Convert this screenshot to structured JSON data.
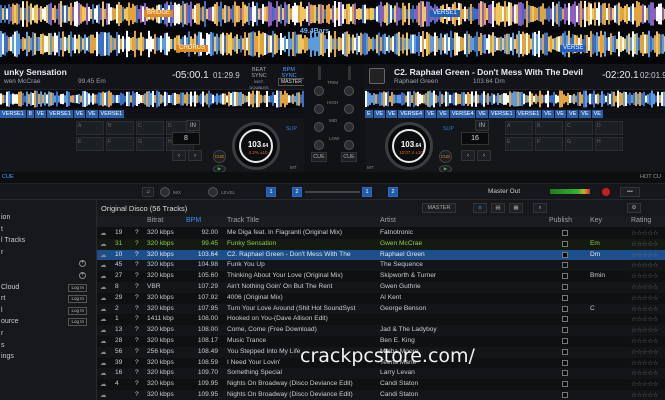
{
  "overview": {
    "markers_top": [
      {
        "label": "BRIDGE",
        "color": "orange"
      },
      {
        "label": "VERSE1",
        "color": "blue"
      }
    ],
    "markers_bottom": [
      {
        "label": "CHORUS",
        "color": "orange"
      },
      {
        "label": "VERSE",
        "color": "blue"
      }
    ],
    "bars_label": "49.4Bars"
  },
  "deck1": {
    "title": "unky Sensation",
    "artist": "wen McCrae",
    "bpm_key": "99.45 Em",
    "remain": "-05:00.1",
    "elapsed": "01:29.9",
    "sync_label": "BEAT SYNC",
    "sync_sub": "INST. DOUBLES",
    "bpm_sync": "BPM SYNC",
    "master": "MASTER",
    "cues": [
      "VERSE1",
      "8",
      "VE",
      "VERSE1",
      "VE",
      "VE",
      "VERSE1"
    ],
    "loop_value": "8",
    "beat_value": "1",
    "jog_bpm": "103",
    "jog_bpm_dec": ".64",
    "jog_sub": "4.2%  ±10",
    "cue_label": "CUE",
    "slip": "SLIP",
    "mt": "MT"
  },
  "deck2": {
    "title": "C2. Raphael Green - Don't Mess With The Devil",
    "artist": "Raphael Green",
    "bpm_key": "103.64 Dm",
    "remain": "-02:20.1",
    "elapsed": "02:01.9",
    "cues": [
      "E",
      "VE",
      "VE",
      "VERSE4",
      "VE",
      "VE",
      "VERSE4",
      "VE",
      "VERSE1",
      "VERSE1",
      "VE",
      "VE",
      "VE",
      "VE",
      "VE"
    ],
    "loop_value": "16",
    "beat_value": "1",
    "jog_bpm": "103",
    "jog_bpm_dec": ".64",
    "jog_sub": "10:07.4  ±10",
    "cue_label": "CUE",
    "slip": "SLIP",
    "mt": "MT"
  },
  "mixer": {
    "trim": "TRIM",
    "high": "HIGH",
    "mid": "MID",
    "low": "LOW",
    "cue": "CUE",
    "left_label": "CUE",
    "right_label": "HOT CU",
    "fx": "MIX",
    "level": "LEVEL"
  },
  "transport": {
    "master_out": "Master Out",
    "rec_label": "REC"
  },
  "sidebar": {
    "items": [
      {
        "label": "ion",
        "extra": ""
      },
      {
        "label": "t",
        "extra": ""
      },
      {
        "label": "l Tracks",
        "extra": ""
      },
      {
        "label": "r",
        "extra": ""
      },
      {
        "label": "",
        "extra": "plus"
      },
      {
        "label": "",
        "extra": "plus"
      },
      {
        "label": "Cloud",
        "extra": "Log In"
      },
      {
        "label": "rt",
        "extra": "Log In"
      },
      {
        "label": "l",
        "extra": "Log In"
      },
      {
        "label": "ource",
        "extra": "Log In"
      },
      {
        "label": "r",
        "extra": ""
      },
      {
        "label": "s",
        "extra": ""
      },
      {
        "label": "ings",
        "extra": ""
      }
    ]
  },
  "library": {
    "title": "Original Disco (56 Tracks)",
    "view_mode": "MASTER",
    "columns": {
      "bitrate": "Bitrat",
      "bpm": "BPM",
      "track": "Track Title",
      "artist": "Artist",
      "publish": "Publish",
      "key": "Key",
      "rating": "Rating"
    },
    "rows": [
      {
        "num": "19",
        "q": "?",
        "bitrate": "320 kbps",
        "bpm": "92.00",
        "title": "Me Diga feat. In Flagranti (Original Mix)",
        "artist": "Fatnotronic",
        "key": "",
        "state": ""
      },
      {
        "num": "31",
        "q": "?",
        "bitrate": "320 kbps",
        "bpm": "99.45",
        "title": "Funky Sensation",
        "artist": "Gwen McCrae",
        "key": "Em",
        "state": "loaded"
      },
      {
        "num": "10",
        "q": "?",
        "bitrate": "320 kbps",
        "bpm": "103.64",
        "title": "C2. Raphael Green - Don't Mess With The",
        "artist": "Raphael Green",
        "key": "Dm",
        "state": "playing"
      },
      {
        "num": "45",
        "q": "?",
        "bitrate": "320 kbps",
        "bpm": "104.98",
        "title": "Funk You Up",
        "artist": "The Sequence",
        "key": "",
        "state": ""
      },
      {
        "num": "27",
        "q": "?",
        "bitrate": "320 kbps",
        "bpm": "105.60",
        "title": "Thinking About Your Love (Original Mix)",
        "artist": "Skipworth & Turner",
        "key": "Bmin",
        "state": ""
      },
      {
        "num": "8",
        "q": "?",
        "bitrate": "VBR",
        "bpm": "107.29",
        "title": "Ain't Nothing Goin' On But The Rent",
        "artist": "Gwen Guthrie",
        "key": "",
        "state": ""
      },
      {
        "num": "29",
        "q": "?",
        "bitrate": "320 kbps",
        "bpm": "107.92",
        "title": "4006 (Original Mix)",
        "artist": "Al Kent",
        "key": "",
        "state": ""
      },
      {
        "num": "2",
        "q": "?",
        "bitrate": "320 kbps",
        "bpm": "107.95",
        "title": "Turn Your Love Around (Shit Hot SoundSyst",
        "artist": "George Benson",
        "key": "C",
        "state": ""
      },
      {
        "num": "1",
        "q": "?",
        "bitrate": "1411 kbp",
        "bpm": "108.00",
        "title": "Hooked on You-(Dave Allison Edit)",
        "artist": "",
        "key": "",
        "state": ""
      },
      {
        "num": "13",
        "q": "?",
        "bitrate": "320 kbps",
        "bpm": "108.00",
        "title": "Come, Come (Free Download)",
        "artist": "Jad & The Ladyboy",
        "key": "",
        "state": ""
      },
      {
        "num": "28",
        "q": "?",
        "bitrate": "320 kbps",
        "bpm": "108.17",
        "title": "Music Trance",
        "artist": "Ben E. King",
        "key": "",
        "state": ""
      },
      {
        "num": "56",
        "q": "?",
        "bitrate": "256 kbps",
        "bpm": "108.49",
        "title": "You Stepped Into My Life",
        "artist": "Melba Moore",
        "key": "",
        "state": ""
      },
      {
        "num": "39",
        "q": "?",
        "bitrate": "320 kbps",
        "bpm": "108.59",
        "title": "I Need Your Lovin'",
        "artist": "Teena Marie",
        "key": "",
        "state": ""
      },
      {
        "num": "16",
        "q": "?",
        "bitrate": "320 kbps",
        "bpm": "109.70",
        "title": "Something Special",
        "artist": "Larry Levan",
        "key": "",
        "state": ""
      },
      {
        "num": "4",
        "q": "?",
        "bitrate": "320 kbps",
        "bpm": "109.95",
        "title": "Nights On Broadway (Disco Deviance Edit)",
        "artist": "Candi Staton",
        "key": "",
        "state": ""
      },
      {
        "num": "",
        "q": "?",
        "bitrate": "320 kbps",
        "bpm": "109.95",
        "title": "Nights On Broadway (Disco Deviance Edit)",
        "artist": "Candi Staton",
        "key": "",
        "state": ""
      }
    ]
  },
  "watermark": "crackpcstore.com/"
}
